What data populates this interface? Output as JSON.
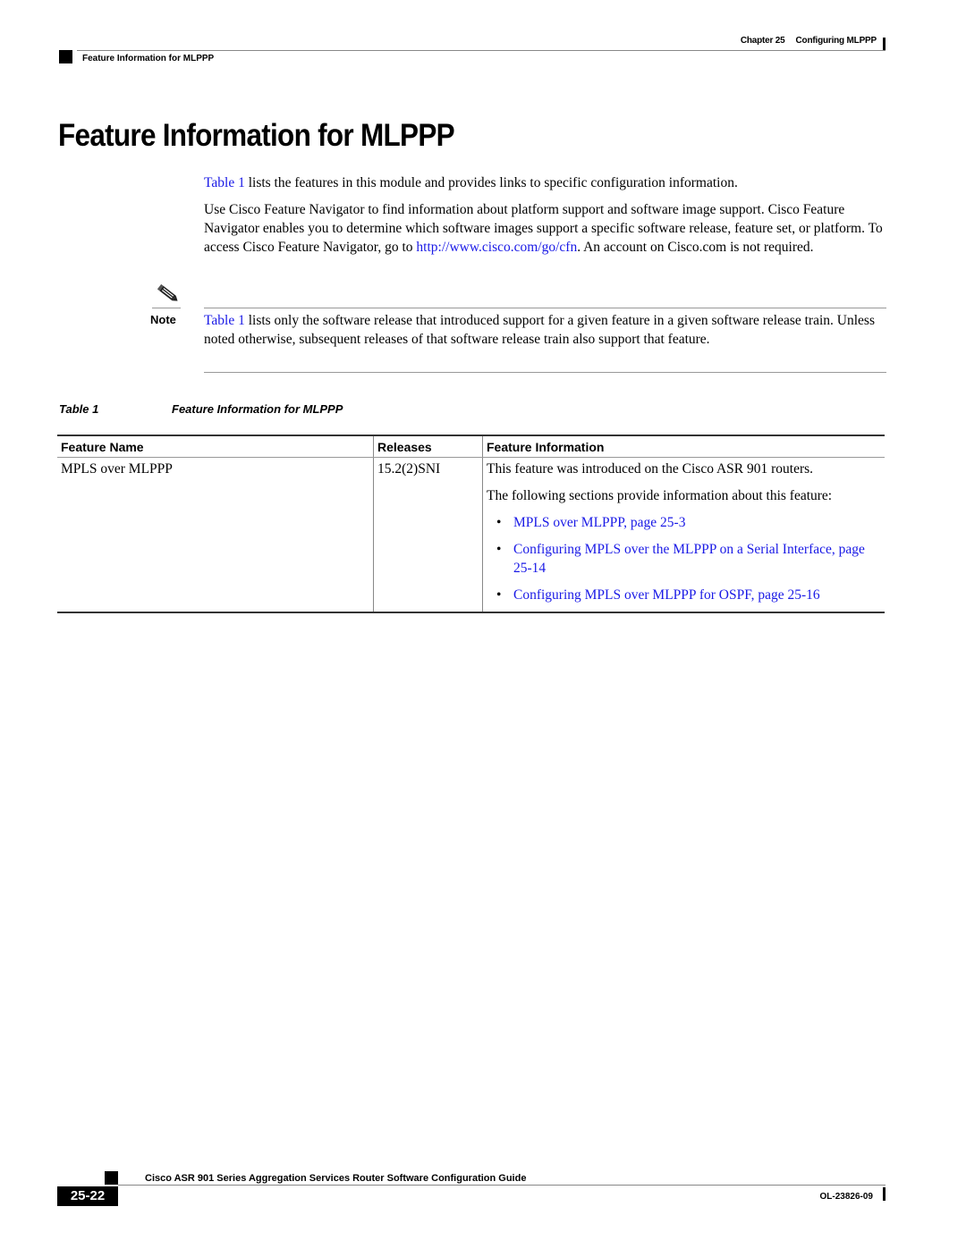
{
  "header": {
    "chapter": "Chapter 25",
    "chapter_title": "Configuring MLPPP",
    "section": "Feature Information for MLPPP"
  },
  "title": "Feature Information for MLPPP",
  "intro": {
    "p1_link": "Table 1",
    "p1_text": " lists the features in this module and provides links to specific configuration information.",
    "p2_text": "Use Cisco Feature Navigator to find information about platform support and software image support. Cisco Feature Navigator enables you to determine which software images support a specific software release, feature set, or platform. To access Cisco Feature Navigator, go to ",
    "p2_link": "http://www.cisco.com/go/cfn",
    "p2_tail": ". An account on Cisco.com is not required."
  },
  "note": {
    "icon": "pencil-note-icon",
    "label": "Note",
    "link": "Table 1",
    "text": " lists only the software release that introduced support for a given feature in a given software release train. Unless noted otherwise, subsequent releases of that software release train also support that feature."
  },
  "table": {
    "caption_number": "Table 1",
    "caption_title": "Feature Information for MLPPP",
    "headers": [
      "Feature Name",
      "Releases",
      "Feature Information"
    ],
    "rows": [
      {
        "feature_name": "MPLS over MLPPP",
        "release": "15.2(2)SNI",
        "info_paragraphs": [
          "This feature was introduced on the Cisco ASR 901 routers.",
          "The following sections provide information about this feature:"
        ],
        "links": [
          "MPLS over MLPPP, page 25-3",
          "Configuring MPLS over the MLPPP on a Serial Interface, page 25-14",
          "Configuring MPLS over MLPPP for OSPF, page 25-16"
        ]
      }
    ]
  },
  "footer": {
    "guide_title": "Cisco ASR 901 Series Aggregation Services Router Software Configuration Guide",
    "page_number": "25-22",
    "doc_number": "OL-23826-09"
  }
}
